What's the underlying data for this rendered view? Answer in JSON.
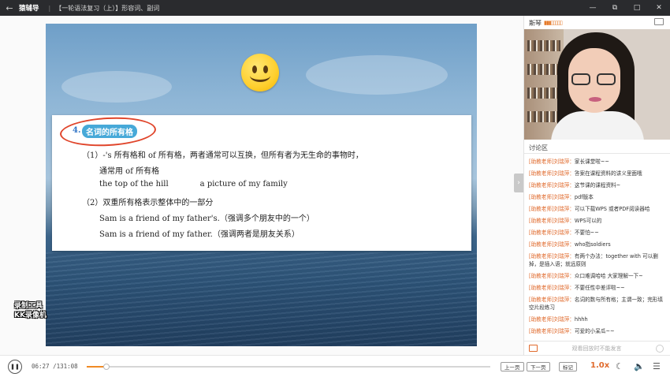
{
  "titlebar": {
    "back_icon": "←",
    "app_name": "猿辅导",
    "separator": "|",
    "course_title": "【一轮语法复习（上）】形容词、副词",
    "window_buttons": [
      "—",
      "⧉",
      "□",
      "✕"
    ]
  },
  "slide": {
    "heading_number": "4.",
    "heading_text": "名词的所有格",
    "lines": [
      "（1）-'s 所有格和 of 所有格，两者通常可以互换，但所有者为无生命的事物时，",
      "通常用 of 所有格",
      "（2）双重所有格表示整体中的一部分",
      "Sam is a friend of my father's.（强调多个朋友中的一个）",
      "Sam is a friend of my father.（强调两者是朋友关系）"
    ],
    "example_a": "the top of the hill",
    "example_b": "a picture of my family"
  },
  "watermark": {
    "line1": "录制工具",
    "line2": "KK录像机"
  },
  "teacher": {
    "name": "斯琴",
    "signal": "▮▮▮▯▯▯▯▯"
  },
  "discussion": {
    "title": "讨论区",
    "messages": [
      {
        "sender": "[助教老师]刘瑞萍：",
        "text": "家长课堂啦~~"
      },
      {
        "sender": "[助教老师]刘瑞萍：",
        "text": "答案在课程资料的讲义里面哦"
      },
      {
        "sender": "[助教老师]刘瑞萍：",
        "text": "这节课的课程资料~"
      },
      {
        "sender": "[助教老师]刘瑞萍：",
        "text": "pdf版本"
      },
      {
        "sender": "[助教老师]刘瑞萍：",
        "text": "可以下载WPS 或者PDF阅读器哈"
      },
      {
        "sender": "[助教老师]刘瑞萍：",
        "text": "WPS可以的"
      },
      {
        "sender": "[助教老师]刘瑞萍：",
        "text": "不要怕~~"
      },
      {
        "sender": "[助教老师]刘瑞萍：",
        "text": "who指soldiers"
      },
      {
        "sender": "[助教老师]刘瑞萍：",
        "text": "有两个办法：together with 可以删掉，是插入语；就远原则"
      },
      {
        "sender": "[助教老师]刘瑞萍：",
        "text": "众口难调哈哈 大家理解一下~"
      },
      {
        "sender": "[助教老师]刘瑞萍：",
        "text": "不要任性中差评啦~~"
      },
      {
        "sender": "[助教老师]刘瑞萍：",
        "text": "名词的数与所有格；主谓一致；完形填空片段练习"
      },
      {
        "sender": "[助教老师]刘瑞萍：",
        "text": "hhhh"
      },
      {
        "sender": "[助教老师]刘瑞萍：",
        "text": "可爱的小呆瓜~~"
      }
    ],
    "input_placeholder": "观看回放时不能发言"
  },
  "player": {
    "pause_icon": "❚❚",
    "time_display": "06:27 /131:08",
    "progress": 0.049,
    "prev_label": "上一页",
    "next_label": "下一页",
    "mark_label": "标记",
    "speed": "1.0x",
    "night_icon": "☾",
    "volume_icon": "🔈",
    "menu_icon": "☰",
    "side_arrow": "›",
    "colors": {
      "accent": "#f08a24",
      "sender": "#e06a2c"
    }
  }
}
